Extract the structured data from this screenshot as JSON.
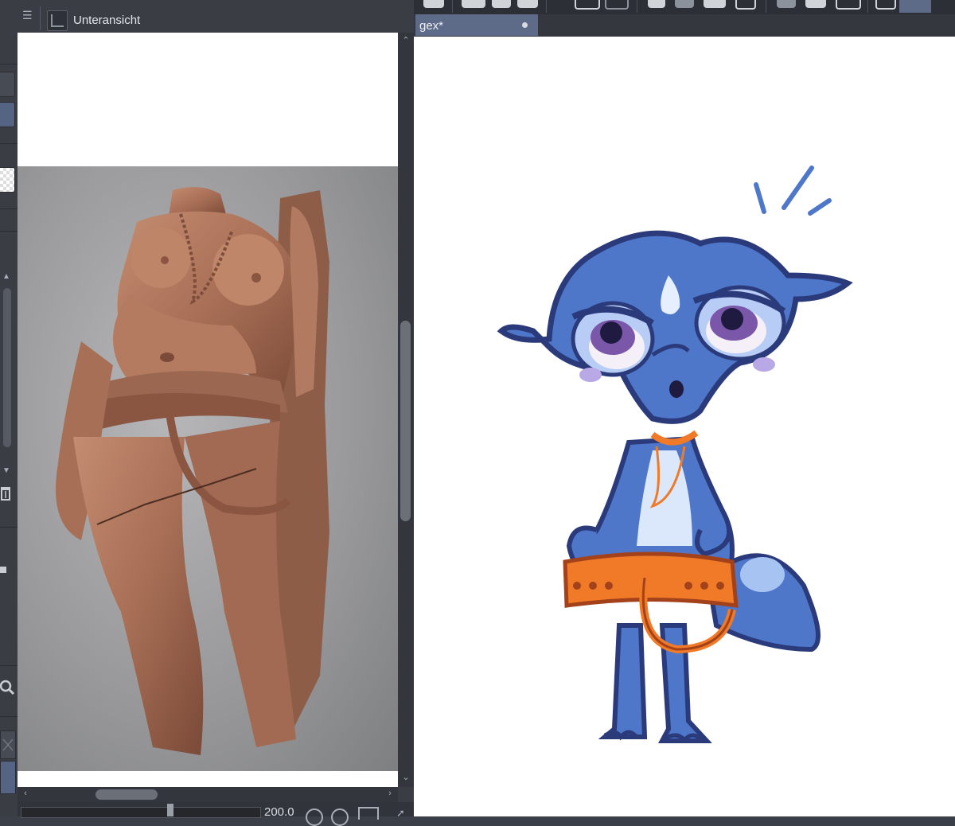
{
  "sub_view": {
    "title": "Unteransicht",
    "zoom_value": "200.0"
  },
  "document": {
    "tab_title": "gex*"
  },
  "icons": {
    "menu": "hamburger-icon",
    "sub_view": "sub-view-icon",
    "trash": "trash-icon",
    "magnifier": "magnifier-icon",
    "rotate": "rotate-icon",
    "fit": "fit-icon",
    "pin": "pin-icon"
  },
  "colors": {
    "panel": "#3a3d44",
    "active_tab": "#5d6a88",
    "character_blue": "#4f77c9",
    "sash_orange": "#f07a28",
    "statue": "#b07a60"
  }
}
